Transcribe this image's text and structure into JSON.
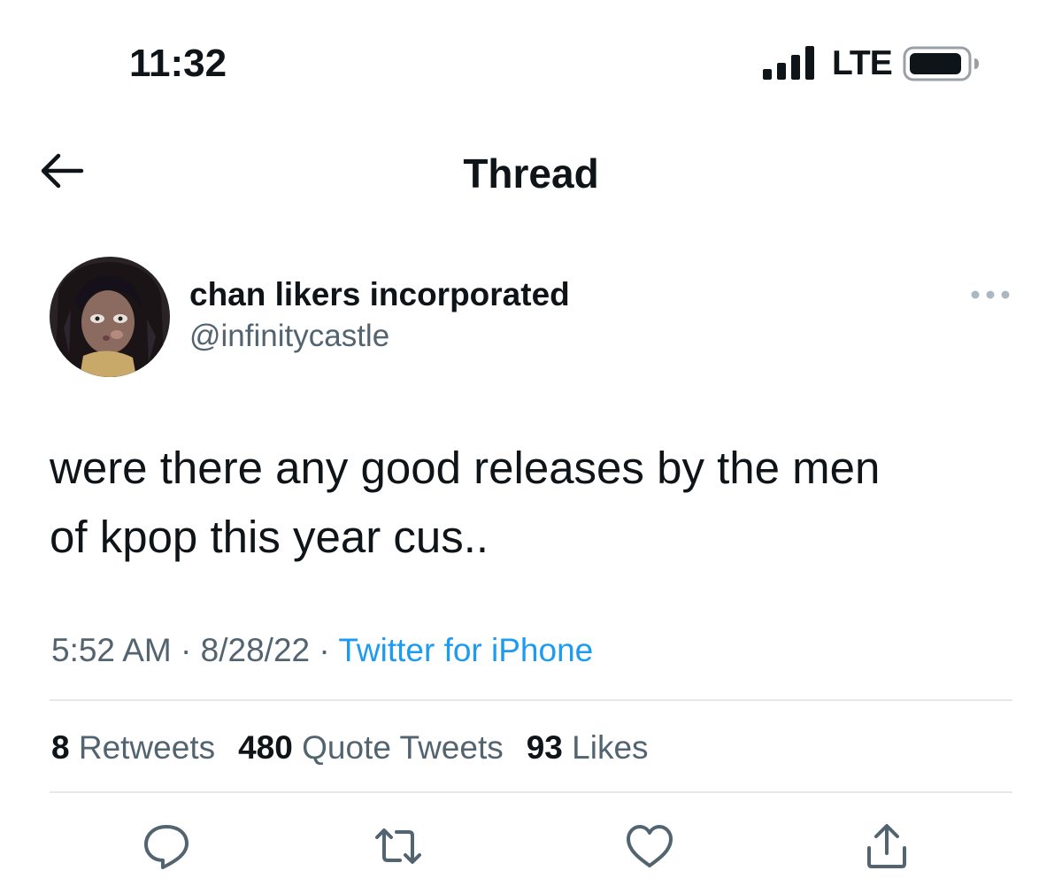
{
  "status_bar": {
    "time": "11:32",
    "network": "LTE"
  },
  "nav": {
    "title": "Thread"
  },
  "tweet": {
    "display_name": "chan likers incorporated",
    "handle": "@infinitycastle",
    "text": "were there any good releases by the men\nof kpop this year cus..",
    "time": "5:52 AM",
    "date": "8/28/22",
    "separator": " · ",
    "source": "Twitter for iPhone",
    "stats": {
      "retweets_count": "8",
      "retweets_label": "Retweets",
      "quotes_count": "480",
      "quotes_label": "Quote Tweets",
      "likes_count": "93",
      "likes_label": "Likes"
    }
  },
  "colors": {
    "text": "#0f1419",
    "secondary": "#536471",
    "link": "#1d9bf0",
    "divider": "#e6e9ec"
  },
  "icons": {
    "back": "arrow-left-icon",
    "more": "more-horizontal-icon",
    "reply": "reply-icon",
    "retweet": "retweet-icon",
    "like": "heart-icon",
    "share": "share-icon",
    "signal": "cellular-signal-icon",
    "battery": "battery-icon"
  }
}
